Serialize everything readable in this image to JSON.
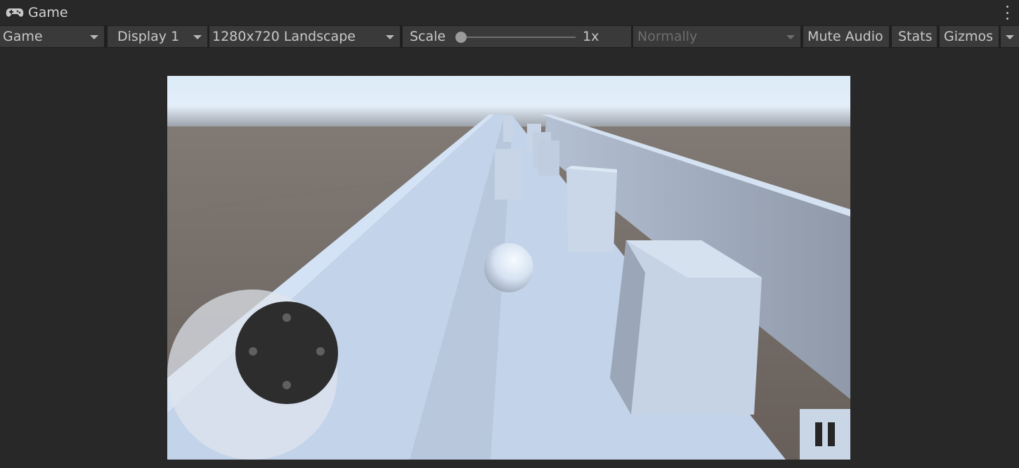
{
  "window": {
    "tab_title": "Game",
    "tab_icon": "gamepad-icon"
  },
  "toolbar": {
    "view_mode": "Game",
    "display": "Display 1",
    "resolution": "1280x720 Landscape",
    "scale_label": "Scale",
    "scale_value": "1x",
    "scale_fraction": 0.0,
    "play_mode": "Normally",
    "mute_audio": "Mute Audio",
    "stats": "Stats",
    "gizmos": "Gizmos"
  },
  "colors": {
    "panel_bg": "#282828",
    "toolbar_bg": "#3a3a3a",
    "sky": "#d6e6f5",
    "ground": "#6b6460",
    "track": "#c7d6ec"
  },
  "game": {
    "joystick": "virtual-joystick",
    "pause_icon": "pause-icon"
  }
}
